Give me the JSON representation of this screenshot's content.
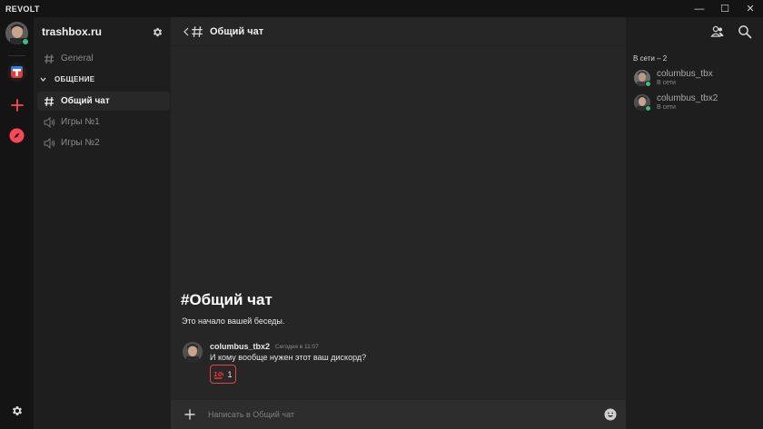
{
  "app": {
    "name": "REVOLT"
  },
  "window_controls": {
    "minimize": "—",
    "maximize": "☐",
    "close": "✕"
  },
  "server": {
    "name": "trashbox.ru"
  },
  "channels": {
    "general": "General",
    "category": "ОБЩЕНИЕ",
    "items": [
      {
        "name": "Общий чат",
        "type": "text",
        "active": true
      },
      {
        "name": "Игры №1",
        "type": "voice"
      },
      {
        "name": "Игры №2",
        "type": "voice"
      }
    ]
  },
  "chat": {
    "title": "Общий чат",
    "intro_title": "#Общий чат",
    "intro_subtitle": "Это начало вашей беседы.",
    "messages": [
      {
        "author": "columbus_tbx2",
        "timestamp": "Сегодня в 11:07",
        "text": "И кому вообще нужен этот ваш дискорд?",
        "reaction": {
          "emoji": "💯",
          "count": "1"
        }
      }
    ],
    "composer_placeholder": "Написать в Общий чат"
  },
  "members": {
    "title": "В сети – 2",
    "list": [
      {
        "name": "columbus_tbx",
        "status": "В сети"
      },
      {
        "name": "columbus_tbx2",
        "status": "В сети"
      }
    ]
  },
  "colors": {
    "online": "#3ABF7E",
    "reaction_border": "#d34a4a",
    "brand_red": "#ff4655"
  }
}
